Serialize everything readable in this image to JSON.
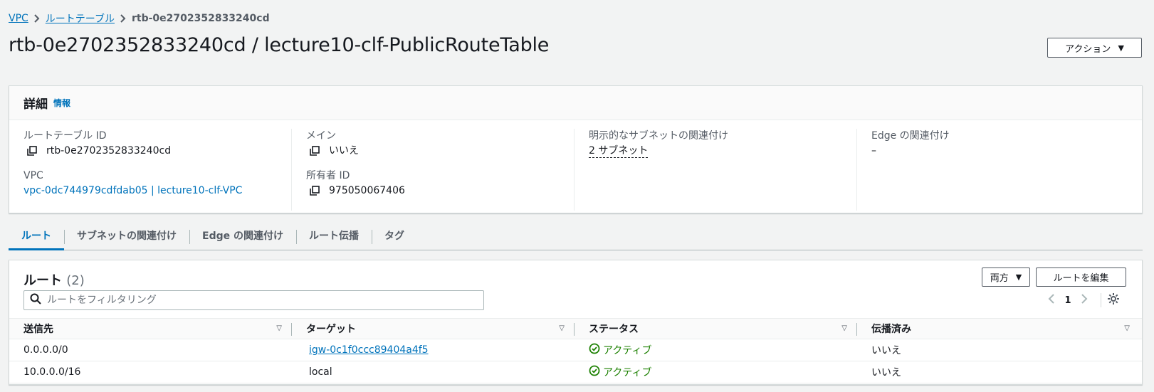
{
  "breadcrumb": {
    "vpc": "VPC",
    "route_tables": "ルートテーブル",
    "current": "rtb-0e2702352833240cd"
  },
  "page_title": "rtb-0e2702352833240cd / lecture10-clf-PublicRouteTable",
  "actions_label": "アクション",
  "details": {
    "title": "詳細",
    "info": "情報",
    "route_table_id_label": "ルートテーブル ID",
    "route_table_id": "rtb-0e2702352833240cd",
    "vpc_label": "VPC",
    "vpc_value": "vpc-0dc744979cdfdab05 | lecture10-clf-VPC",
    "main_label": "メイン",
    "main_value": "いいえ",
    "owner_label": "所有者 ID",
    "owner_value": "975050067406",
    "subnet_assoc_label": "明示的なサブネットの関連付け",
    "subnet_assoc_value": "2 サブネット",
    "edge_label": "Edge の関連付け",
    "edge_value": "–"
  },
  "tabs": [
    "ルート",
    "サブネットの関連付け",
    "Edge の関連付け",
    "ルート伝播",
    "タグ"
  ],
  "routes": {
    "title": "ルート",
    "count": "(2)",
    "filter_label": "両方",
    "edit_label": "ルートを編集",
    "search_placeholder": "ルートをフィルタリング",
    "page": "1",
    "columns": [
      "送信先",
      "ターゲット",
      "ステータス",
      "伝播済み"
    ],
    "rows": [
      {
        "destination": "0.0.0.0/0",
        "target": "igw-0c1f0ccc89404a4f5",
        "status": "アクティブ",
        "propagated": "いいえ"
      },
      {
        "destination": "10.0.0.0/16",
        "target": "local",
        "status": "アクティブ",
        "propagated": "いいえ"
      }
    ]
  },
  "colors": {
    "link": "#0073bb",
    "success": "#1d8102",
    "text": "#16191f"
  }
}
